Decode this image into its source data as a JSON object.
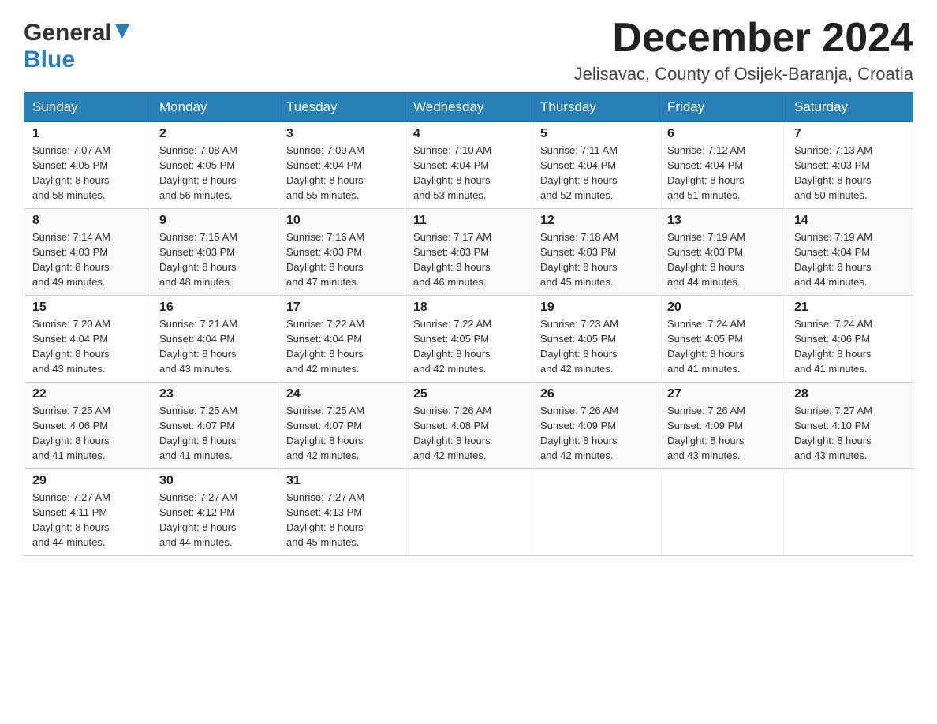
{
  "logo": {
    "general": "General",
    "blue": "Blue"
  },
  "header": {
    "month_year": "December 2024",
    "location": "Jelisavac, County of Osijek-Baranja, Croatia"
  },
  "days_of_week": [
    "Sunday",
    "Monday",
    "Tuesday",
    "Wednesday",
    "Thursday",
    "Friday",
    "Saturday"
  ],
  "weeks": [
    [
      {
        "day": "1",
        "sunrise": "Sunrise: 7:07 AM",
        "sunset": "Sunset: 4:05 PM",
        "daylight": "Daylight: 8 hours",
        "daylight2": "and 58 minutes."
      },
      {
        "day": "2",
        "sunrise": "Sunrise: 7:08 AM",
        "sunset": "Sunset: 4:05 PM",
        "daylight": "Daylight: 8 hours",
        "daylight2": "and 56 minutes."
      },
      {
        "day": "3",
        "sunrise": "Sunrise: 7:09 AM",
        "sunset": "Sunset: 4:04 PM",
        "daylight": "Daylight: 8 hours",
        "daylight2": "and 55 minutes."
      },
      {
        "day": "4",
        "sunrise": "Sunrise: 7:10 AM",
        "sunset": "Sunset: 4:04 PM",
        "daylight": "Daylight: 8 hours",
        "daylight2": "and 53 minutes."
      },
      {
        "day": "5",
        "sunrise": "Sunrise: 7:11 AM",
        "sunset": "Sunset: 4:04 PM",
        "daylight": "Daylight: 8 hours",
        "daylight2": "and 52 minutes."
      },
      {
        "day": "6",
        "sunrise": "Sunrise: 7:12 AM",
        "sunset": "Sunset: 4:04 PM",
        "daylight": "Daylight: 8 hours",
        "daylight2": "and 51 minutes."
      },
      {
        "day": "7",
        "sunrise": "Sunrise: 7:13 AM",
        "sunset": "Sunset: 4:03 PM",
        "daylight": "Daylight: 8 hours",
        "daylight2": "and 50 minutes."
      }
    ],
    [
      {
        "day": "8",
        "sunrise": "Sunrise: 7:14 AM",
        "sunset": "Sunset: 4:03 PM",
        "daylight": "Daylight: 8 hours",
        "daylight2": "and 49 minutes."
      },
      {
        "day": "9",
        "sunrise": "Sunrise: 7:15 AM",
        "sunset": "Sunset: 4:03 PM",
        "daylight": "Daylight: 8 hours",
        "daylight2": "and 48 minutes."
      },
      {
        "day": "10",
        "sunrise": "Sunrise: 7:16 AM",
        "sunset": "Sunset: 4:03 PM",
        "daylight": "Daylight: 8 hours",
        "daylight2": "and 47 minutes."
      },
      {
        "day": "11",
        "sunrise": "Sunrise: 7:17 AM",
        "sunset": "Sunset: 4:03 PM",
        "daylight": "Daylight: 8 hours",
        "daylight2": "and 46 minutes."
      },
      {
        "day": "12",
        "sunrise": "Sunrise: 7:18 AM",
        "sunset": "Sunset: 4:03 PM",
        "daylight": "Daylight: 8 hours",
        "daylight2": "and 45 minutes."
      },
      {
        "day": "13",
        "sunrise": "Sunrise: 7:19 AM",
        "sunset": "Sunset: 4:03 PM",
        "daylight": "Daylight: 8 hours",
        "daylight2": "and 44 minutes."
      },
      {
        "day": "14",
        "sunrise": "Sunrise: 7:19 AM",
        "sunset": "Sunset: 4:04 PM",
        "daylight": "Daylight: 8 hours",
        "daylight2": "and 44 minutes."
      }
    ],
    [
      {
        "day": "15",
        "sunrise": "Sunrise: 7:20 AM",
        "sunset": "Sunset: 4:04 PM",
        "daylight": "Daylight: 8 hours",
        "daylight2": "and 43 minutes."
      },
      {
        "day": "16",
        "sunrise": "Sunrise: 7:21 AM",
        "sunset": "Sunset: 4:04 PM",
        "daylight": "Daylight: 8 hours",
        "daylight2": "and 43 minutes."
      },
      {
        "day": "17",
        "sunrise": "Sunrise: 7:22 AM",
        "sunset": "Sunset: 4:04 PM",
        "daylight": "Daylight: 8 hours",
        "daylight2": "and 42 minutes."
      },
      {
        "day": "18",
        "sunrise": "Sunrise: 7:22 AM",
        "sunset": "Sunset: 4:05 PM",
        "daylight": "Daylight: 8 hours",
        "daylight2": "and 42 minutes."
      },
      {
        "day": "19",
        "sunrise": "Sunrise: 7:23 AM",
        "sunset": "Sunset: 4:05 PM",
        "daylight": "Daylight: 8 hours",
        "daylight2": "and 42 minutes."
      },
      {
        "day": "20",
        "sunrise": "Sunrise: 7:24 AM",
        "sunset": "Sunset: 4:05 PM",
        "daylight": "Daylight: 8 hours",
        "daylight2": "and 41 minutes."
      },
      {
        "day": "21",
        "sunrise": "Sunrise: 7:24 AM",
        "sunset": "Sunset: 4:06 PM",
        "daylight": "Daylight: 8 hours",
        "daylight2": "and 41 minutes."
      }
    ],
    [
      {
        "day": "22",
        "sunrise": "Sunrise: 7:25 AM",
        "sunset": "Sunset: 4:06 PM",
        "daylight": "Daylight: 8 hours",
        "daylight2": "and 41 minutes."
      },
      {
        "day": "23",
        "sunrise": "Sunrise: 7:25 AM",
        "sunset": "Sunset: 4:07 PM",
        "daylight": "Daylight: 8 hours",
        "daylight2": "and 41 minutes."
      },
      {
        "day": "24",
        "sunrise": "Sunrise: 7:25 AM",
        "sunset": "Sunset: 4:07 PM",
        "daylight": "Daylight: 8 hours",
        "daylight2": "and 42 minutes."
      },
      {
        "day": "25",
        "sunrise": "Sunrise: 7:26 AM",
        "sunset": "Sunset: 4:08 PM",
        "daylight": "Daylight: 8 hours",
        "daylight2": "and 42 minutes."
      },
      {
        "day": "26",
        "sunrise": "Sunrise: 7:26 AM",
        "sunset": "Sunset: 4:09 PM",
        "daylight": "Daylight: 8 hours",
        "daylight2": "and 42 minutes."
      },
      {
        "day": "27",
        "sunrise": "Sunrise: 7:26 AM",
        "sunset": "Sunset: 4:09 PM",
        "daylight": "Daylight: 8 hours",
        "daylight2": "and 43 minutes."
      },
      {
        "day": "28",
        "sunrise": "Sunrise: 7:27 AM",
        "sunset": "Sunset: 4:10 PM",
        "daylight": "Daylight: 8 hours",
        "daylight2": "and 43 minutes."
      }
    ],
    [
      {
        "day": "29",
        "sunrise": "Sunrise: 7:27 AM",
        "sunset": "Sunset: 4:11 PM",
        "daylight": "Daylight: 8 hours",
        "daylight2": "and 44 minutes."
      },
      {
        "day": "30",
        "sunrise": "Sunrise: 7:27 AM",
        "sunset": "Sunset: 4:12 PM",
        "daylight": "Daylight: 8 hours",
        "daylight2": "and 44 minutes."
      },
      {
        "day": "31",
        "sunrise": "Sunrise: 7:27 AM",
        "sunset": "Sunset: 4:13 PM",
        "daylight": "Daylight: 8 hours",
        "daylight2": "and 45 minutes."
      },
      null,
      null,
      null,
      null
    ]
  ]
}
